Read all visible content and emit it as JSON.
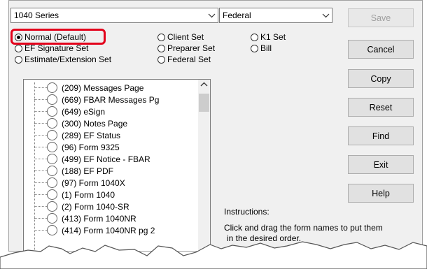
{
  "series_combo": {
    "value": "1040 Series",
    "arrow_icon": "chevron-down-icon"
  },
  "jurisdiction_combo": {
    "value": "Federal",
    "arrow_icon": "chevron-down-icon"
  },
  "radios": {
    "normal": {
      "label": "Normal (Default)",
      "checked": true
    },
    "ef_signature": {
      "label": "EF Signature Set",
      "checked": false
    },
    "estimate_extension": {
      "label": "Estimate/Extension Set",
      "checked": false
    },
    "client": {
      "label": "Client Set",
      "checked": false
    },
    "preparer": {
      "label": "Preparer Set",
      "checked": false
    },
    "federal": {
      "label": "Federal Set",
      "checked": false
    },
    "k1": {
      "label": "K1 Set",
      "checked": false
    },
    "bill": {
      "label": "Bill",
      "checked": false
    }
  },
  "buttons": {
    "save": "Save",
    "cancel": "Cancel",
    "copy": "Copy",
    "reset": "Reset",
    "find": "Find",
    "exit": "Exit",
    "help": "Help"
  },
  "form_list": [
    "(209) Messages Page",
    "(669) FBAR Messages Pg",
    "(649) eSign",
    "(300) Notes Page",
    "(289) EF Status",
    "(96) Form 9325",
    "(499) EF Notice - FBAR",
    "(188) EF PDF",
    "(97) Form 1040X",
    "(1) Form 1040",
    "(2) Form 1040-SR",
    "(413) Form 1040NR",
    "(414) Form 1040NR pg 2"
  ],
  "instructions": {
    "heading": "Instructions:",
    "line1": "Click and drag the form names to put them",
    "line2": "in the desired order."
  },
  "colors": {
    "highlight": "#e3001b",
    "dialog_bg": "#f0f0f0"
  }
}
